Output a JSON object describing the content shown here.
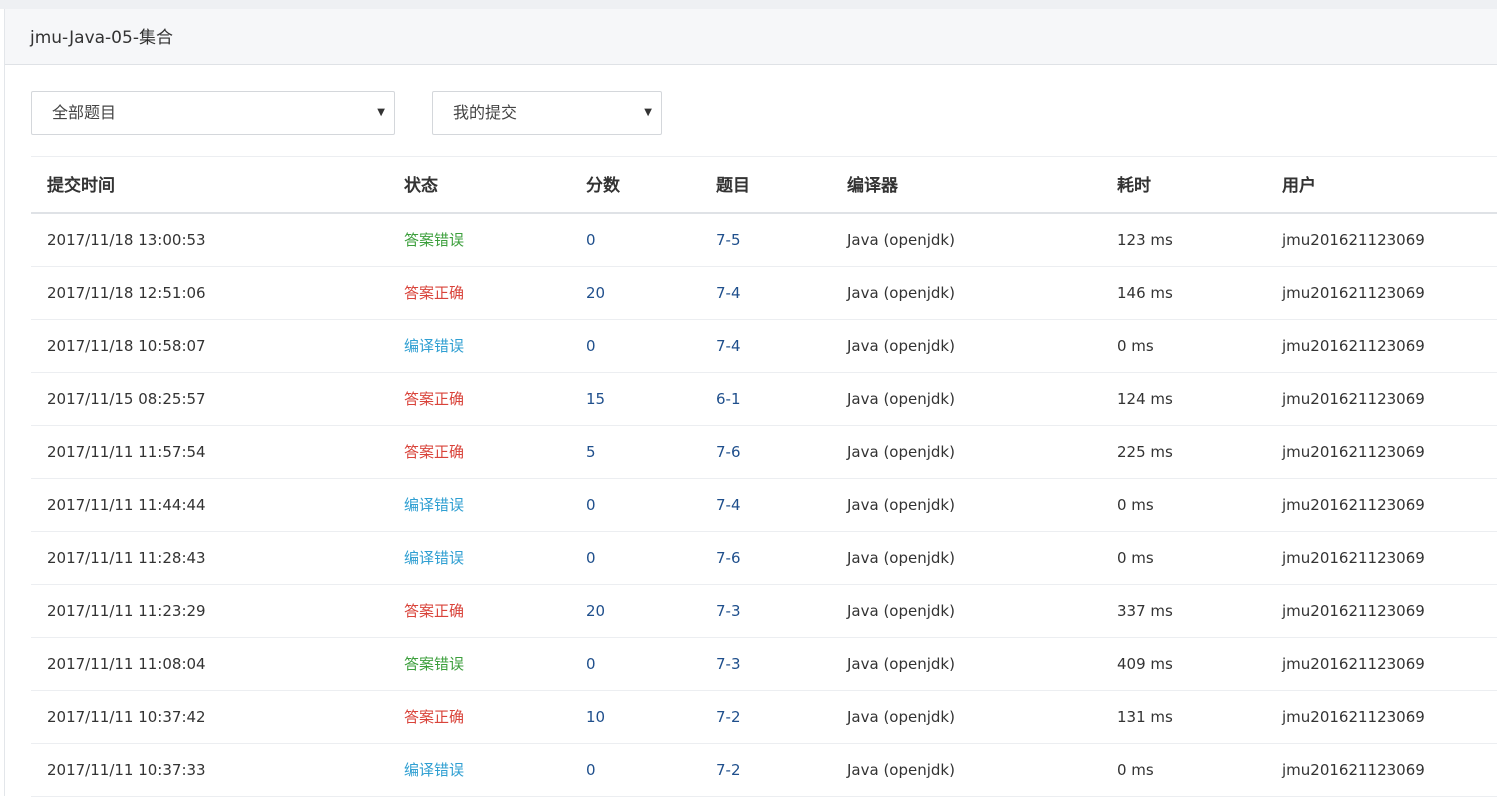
{
  "panel": {
    "title": "jmu-Java-05-集合"
  },
  "filters": {
    "problem_select": "全部题目",
    "submission_select": "我的提交"
  },
  "table": {
    "headers": [
      "提交时间",
      "状态",
      "分数",
      "题目",
      "编译器",
      "耗时",
      "用户"
    ],
    "rows": [
      {
        "time": "2017/11/18 13:00:53",
        "status": "答案错误",
        "status_color": "#3c9f3c",
        "score": "0",
        "problem": "7-5",
        "compiler": "Java (openjdk)",
        "duration": "123 ms",
        "user": "jmu201621123069"
      },
      {
        "time": "2017/11/18 12:51:06",
        "status": "答案正确",
        "status_color": "#d9433a",
        "score": "20",
        "problem": "7-4",
        "compiler": "Java (openjdk)",
        "duration": "146 ms",
        "user": "jmu201621123069"
      },
      {
        "time": "2017/11/18 10:58:07",
        "status": "编译错误",
        "status_color": "#2f9fd2",
        "score": "0",
        "problem": "7-4",
        "compiler": "Java (openjdk)",
        "duration": "0 ms",
        "user": "jmu201621123069"
      },
      {
        "time": "2017/11/15 08:25:57",
        "status": "答案正确",
        "status_color": "#d9433a",
        "score": "15",
        "problem": "6-1",
        "compiler": "Java (openjdk)",
        "duration": "124 ms",
        "user": "jmu201621123069"
      },
      {
        "time": "2017/11/11 11:57:54",
        "status": "答案正确",
        "status_color": "#d9433a",
        "score": "5",
        "problem": "7-6",
        "compiler": "Java (openjdk)",
        "duration": "225 ms",
        "user": "jmu201621123069"
      },
      {
        "time": "2017/11/11 11:44:44",
        "status": "编译错误",
        "status_color": "#2f9fd2",
        "score": "0",
        "problem": "7-4",
        "compiler": "Java (openjdk)",
        "duration": "0 ms",
        "user": "jmu201621123069"
      },
      {
        "time": "2017/11/11 11:28:43",
        "status": "编译错误",
        "status_color": "#2f9fd2",
        "score": "0",
        "problem": "7-6",
        "compiler": "Java (openjdk)",
        "duration": "0 ms",
        "user": "jmu201621123069"
      },
      {
        "time": "2017/11/11 11:23:29",
        "status": "答案正确",
        "status_color": "#d9433a",
        "score": "20",
        "problem": "7-3",
        "compiler": "Java (openjdk)",
        "duration": "337 ms",
        "user": "jmu201621123069"
      },
      {
        "time": "2017/11/11 11:08:04",
        "status": "答案错误",
        "status_color": "#3c9f3c",
        "score": "0",
        "problem": "7-3",
        "compiler": "Java (openjdk)",
        "duration": "409 ms",
        "user": "jmu201621123069"
      },
      {
        "time": "2017/11/11 10:37:42",
        "status": "答案正确",
        "status_color": "#d9433a",
        "score": "10",
        "problem": "7-2",
        "compiler": "Java (openjdk)",
        "duration": "131 ms",
        "user": "jmu201621123069"
      },
      {
        "time": "2017/11/11 10:37:33",
        "status": "编译错误",
        "status_color": "#2f9fd2",
        "score": "0",
        "problem": "7-2",
        "compiler": "Java (openjdk)",
        "duration": "0 ms",
        "user": "jmu201621123069"
      }
    ]
  }
}
